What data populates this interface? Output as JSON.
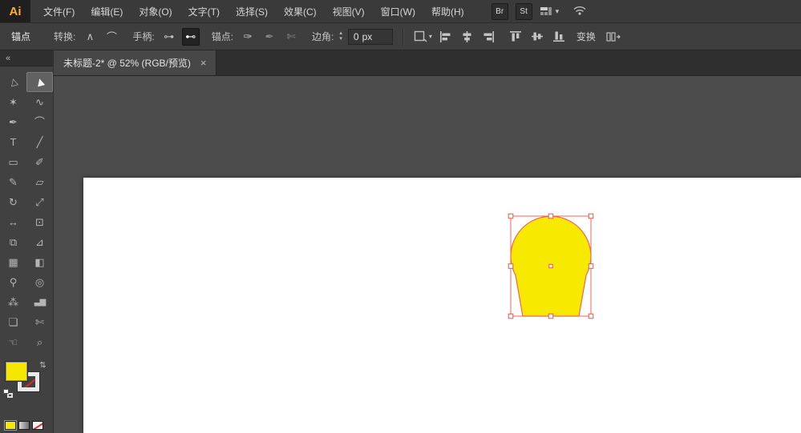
{
  "colors": {
    "shape_fill": "#f7ea00",
    "selection": "#ef6458",
    "fill_swatch": "#f6e700",
    "logo_accent": "#ffb12b"
  },
  "menu_bar": {
    "logo": "Ai",
    "items": [
      {
        "label": "文件(F)"
      },
      {
        "label": "编辑(E)"
      },
      {
        "label": "对象(O)"
      },
      {
        "label": "文字(T)"
      },
      {
        "label": "选择(S)"
      },
      {
        "label": "效果(C)"
      },
      {
        "label": "视图(V)"
      },
      {
        "label": "窗口(W)"
      },
      {
        "label": "帮助(H)"
      }
    ],
    "bridge_label": "Br",
    "stock_label": "St"
  },
  "control_bar": {
    "context_label": "锚点",
    "convert_label": "转换:",
    "handles_label": "手柄:",
    "anchor_label": "锚点:",
    "corner_label": "边角:",
    "corner_value": "0",
    "corner_unit": "px",
    "transform_label": "变换"
  },
  "glyphs": {
    "collapse": "«",
    "close": "×",
    "caret_down": "▾",
    "spinner_up": "▴",
    "spinner_down": "▾",
    "swap": "⇄",
    "convert_corner": "∧",
    "convert_smooth": "⌒",
    "handle_show": "⊶",
    "handle_hide": "⊷",
    "anchor_remove": "✑",
    "anchor_add": "✒",
    "anchor_cut": "✄"
  },
  "document_tab": {
    "title": "未标题-2* @ 52% (RGB/预览)"
  },
  "toolbar": {
    "tools": [
      {
        "name": "selection-tool",
        "glyph": "▷"
      },
      {
        "name": "direct-selection-tool",
        "glyph": "▶",
        "selected": true
      },
      {
        "name": "magic-wand-tool",
        "glyph": "✶"
      },
      {
        "name": "lasso-tool",
        "glyph": "∿"
      },
      {
        "name": "pen-tool",
        "glyph": "✒"
      },
      {
        "name": "curvature-tool",
        "glyph": "⌒"
      },
      {
        "name": "type-tool",
        "glyph": "T"
      },
      {
        "name": "line-segment-tool",
        "glyph": "╱"
      },
      {
        "name": "rectangle-tool",
        "glyph": "▭"
      },
      {
        "name": "paintbrush-tool",
        "glyph": "✐"
      },
      {
        "name": "pencil-tool",
        "glyph": "✎"
      },
      {
        "name": "eraser-tool",
        "glyph": "▱"
      },
      {
        "name": "rotate-tool",
        "glyph": "↻"
      },
      {
        "name": "scale-tool",
        "glyph": "⤢"
      },
      {
        "name": "width-tool",
        "glyph": "↔"
      },
      {
        "name": "free-transform-tool",
        "glyph": "⊡"
      },
      {
        "name": "shape-builder-tool",
        "glyph": "⧉"
      },
      {
        "name": "perspective-grid-tool",
        "glyph": "⊿"
      },
      {
        "name": "mesh-tool",
        "glyph": "▦"
      },
      {
        "name": "gradient-tool",
        "glyph": "◧"
      },
      {
        "name": "eyedropper-tool",
        "glyph": "⚲"
      },
      {
        "name": "blend-tool",
        "glyph": "◎"
      },
      {
        "name": "symbol-sprayer-tool",
        "glyph": "⁂"
      },
      {
        "name": "column-graph-tool",
        "glyph": "▃▆"
      },
      {
        "name": "artboard-tool",
        "glyph": "❏"
      },
      {
        "name": "slice-tool",
        "glyph": "✄"
      },
      {
        "name": "hand-tool",
        "glyph": "☜"
      },
      {
        "name": "zoom-tool",
        "glyph": "⌕"
      }
    ]
  }
}
